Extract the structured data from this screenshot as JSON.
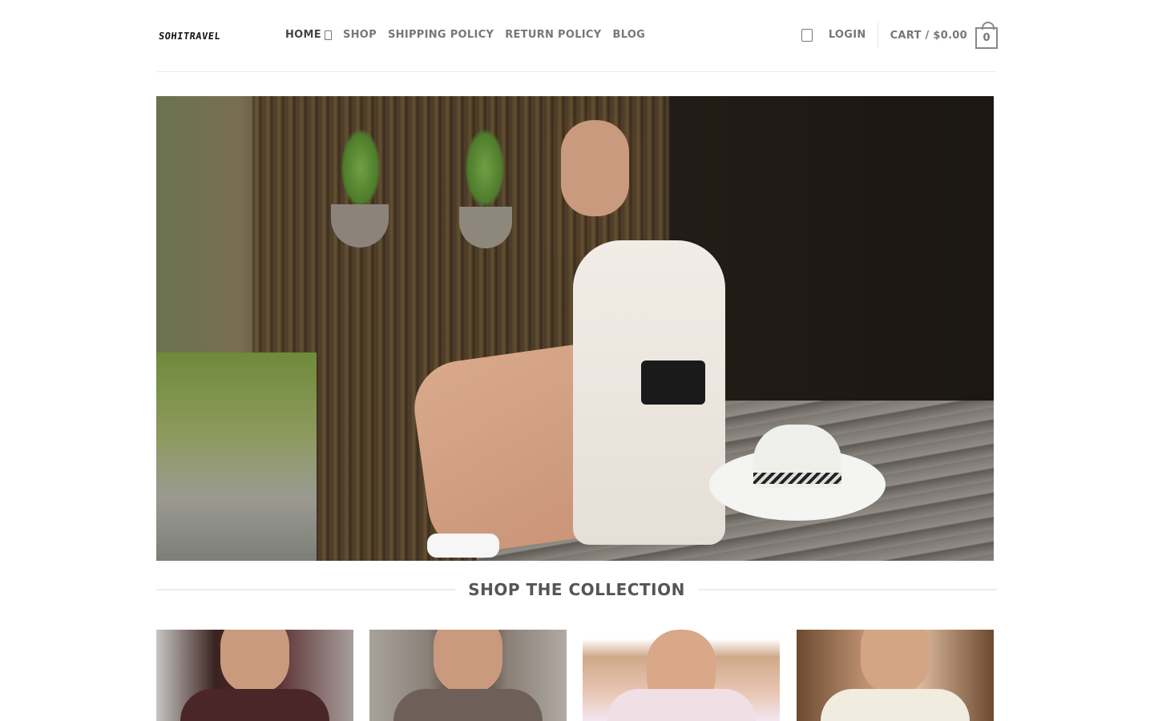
{
  "header": {
    "logo": "SOHITRAVEL",
    "nav": [
      {
        "label": "HOME",
        "has_dropdown": true
      },
      {
        "label": "SHOP"
      },
      {
        "label": "SHIPPING POLICY"
      },
      {
        "label": "RETURN POLICY"
      },
      {
        "label": "BLOG"
      }
    ],
    "search_icon": "search-icon",
    "login_label": "LOGIN",
    "cart_label": "CART / $0.00",
    "cart_count": "0"
  },
  "hero": {
    "image": "woman-in-white-dress-with-camera-and-hat"
  },
  "section": {
    "title": "SHOP THE COLLECTION"
  },
  "products": [
    {
      "image": "woman-in-burgundy-floral-top"
    },
    {
      "image": "woman-with-curly-hair-portrait"
    },
    {
      "image": "woman-in-straw-hat-with-necklaces"
    },
    {
      "image": "woman-in-white-halter-top"
    }
  ],
  "colors": {
    "nav_text": "#777777",
    "title_text": "#555555",
    "divider": "#ececec"
  }
}
